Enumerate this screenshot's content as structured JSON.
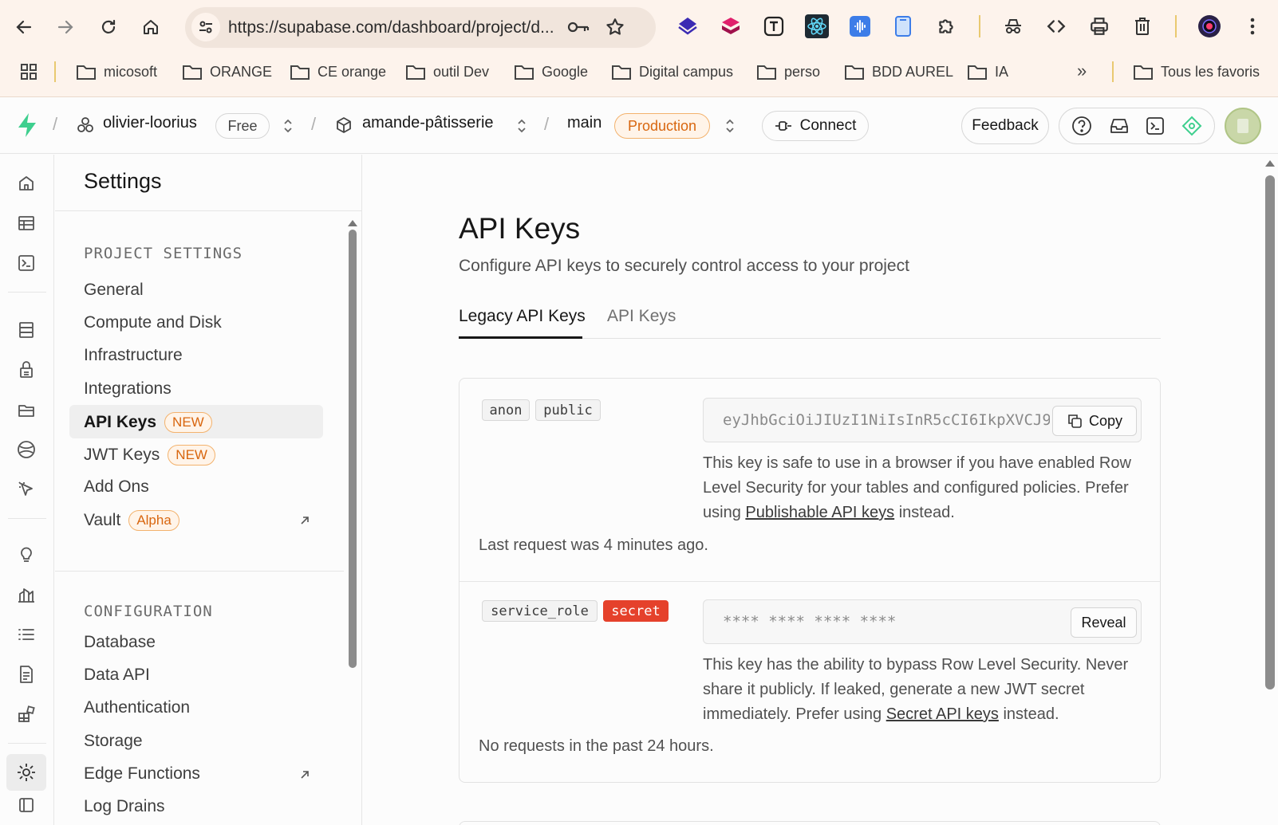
{
  "browser": {
    "url": "https://supabase.com/dashboard/project/d...",
    "bookmarks": [
      "micosoft",
      "ORANGE",
      "CE orange",
      "outil Dev",
      "Google",
      "Digital campus",
      "perso",
      "BDD AUREL",
      "IA"
    ],
    "all_bookmarks": "Tous les favoris",
    "overflow": "»"
  },
  "header": {
    "org": "olivier-loorius",
    "plan": "Free",
    "project": "amande-pâtisserie",
    "branch": "main",
    "env": "Production",
    "connect": "Connect",
    "feedback": "Feedback",
    "separator": "/"
  },
  "sidebar": {
    "title": "Settings",
    "project_settings_label": "PROJECT SETTINGS",
    "project_items": [
      {
        "label": "General"
      },
      {
        "label": "Compute and Disk"
      },
      {
        "label": "Infrastructure"
      },
      {
        "label": "Integrations"
      },
      {
        "label": "API Keys",
        "badge": "NEW"
      },
      {
        "label": "JWT Keys",
        "badge": "NEW"
      },
      {
        "label": "Add Ons"
      },
      {
        "label": "Vault",
        "badge": "Alpha"
      }
    ],
    "configuration_label": "CONFIGURATION",
    "config_items": [
      {
        "label": "Database"
      },
      {
        "label": "Data API"
      },
      {
        "label": "Authentication"
      },
      {
        "label": "Storage"
      },
      {
        "label": "Edge Functions"
      },
      {
        "label": "Log Drains"
      }
    ]
  },
  "main": {
    "title": "API Keys",
    "subtitle": "Configure API keys to securely control access to your project",
    "tabs": [
      {
        "label": "Legacy API Keys"
      },
      {
        "label": "API Keys"
      }
    ],
    "keys": [
      {
        "tags": [
          "anon",
          "public"
        ],
        "value": "eyJhbGciOiJIUzI1NiIsInR5cCI6IkpXVCJ9",
        "button": "Copy",
        "desc_pre": "This key is safe to use in a browser if you have enabled Row Level Security for your tables and configured policies. Prefer using ",
        "desc_link": "Publishable API keys",
        "desc_post": " instead.",
        "last": "Last request was 4 minutes ago."
      },
      {
        "tags": [
          "service_role",
          "secret"
        ],
        "value": "**** **** **** ****",
        "button": "Reveal",
        "desc_pre": "This key has the ability to bypass Row Level Security. Never share it publicly. If leaked, generate a new JWT secret immediately. Prefer using ",
        "desc_link": "Secret API keys",
        "desc_post": " instead.",
        "last": "No requests in the past 24 hours."
      }
    ]
  },
  "colors": {
    "brand": "#3ecf8e",
    "accent_orange": "#d8660f",
    "secret_red": "#e5412b"
  }
}
